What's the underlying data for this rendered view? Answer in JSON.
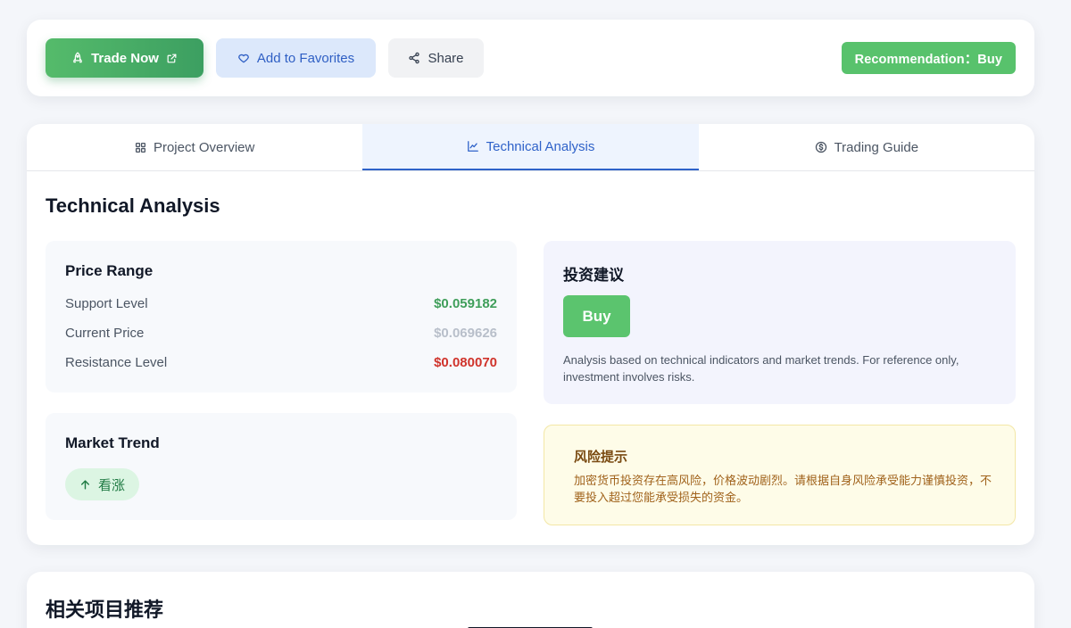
{
  "actions": {
    "trade_now": "Trade Now",
    "add_favorites": "Add to Favorites",
    "share": "Share",
    "recommendation": "Recommendation：Buy"
  },
  "tabs": [
    {
      "label": "Project Overview",
      "icon": "grid-icon",
      "active": false
    },
    {
      "label": "Technical Analysis",
      "icon": "chart-line-icon",
      "active": true
    },
    {
      "label": "Trading Guide",
      "icon": "dollar-circle-icon",
      "active": false
    }
  ],
  "technical": {
    "title": "Technical Analysis",
    "price_range": {
      "title": "Price Range",
      "rows": [
        {
          "label": "Support Level",
          "value": "$0.059182",
          "color": "#3f9e5a"
        },
        {
          "label": "Current Price",
          "value": "$0.069626",
          "color": "#b8bfca"
        },
        {
          "label": "Resistance Level",
          "value": "$0.080070",
          "color": "#d0342c"
        }
      ]
    },
    "market_trend": {
      "title": "Market Trend",
      "value": "看涨",
      "icon": "arrow-up-icon"
    },
    "advice": {
      "title": "投资建议",
      "action": "Buy",
      "note": "Analysis based on technical indicators and market trends. For reference only, investment involves risks."
    },
    "risk": {
      "title": "风险提示",
      "text": "加密货币投资存在高风险，价格波动剧烈。请根据自身风险承受能力谨慎投资，不要投入超过您能承受损失的资金。"
    }
  },
  "related": {
    "title": "相关项目推荐"
  },
  "colors": {
    "accent_blue": "#2f62c9",
    "buy_green": "#58c26c",
    "page_bg": "#f4f6fa"
  }
}
